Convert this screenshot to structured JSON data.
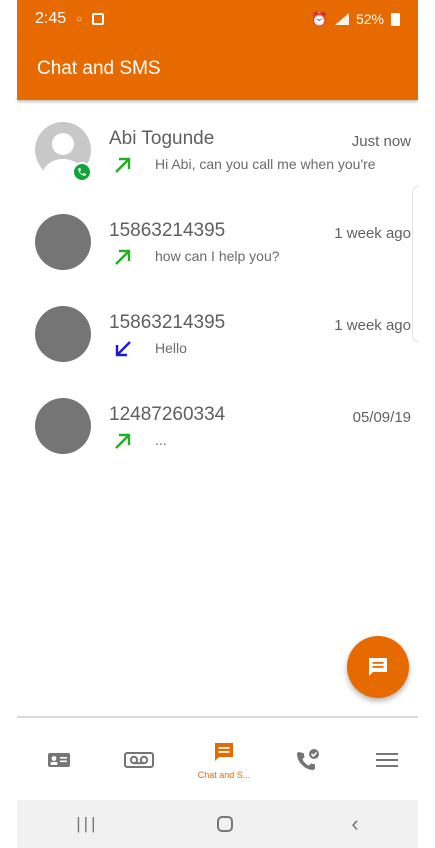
{
  "status_bar": {
    "time": "2:45",
    "battery": "52%"
  },
  "app_bar": {
    "title": "Chat and SMS"
  },
  "conversations": [
    {
      "name": "Abi Togunde",
      "time": "Just now",
      "direction": "outgoing",
      "snippet": "Hi Abi, can you call me when you're"
    },
    {
      "name": "15863214395",
      "time": "1 week ago",
      "direction": "outgoing",
      "snippet": "how can I help you?"
    },
    {
      "name": "15863214395",
      "time": "1 week ago",
      "direction": "incoming",
      "snippet": "Hello"
    },
    {
      "name": "12487260334",
      "time": "05/09/19",
      "direction": "outgoing",
      "snippet": "..."
    }
  ],
  "bottom_nav": {
    "active_label": "Chat and S..."
  },
  "colors": {
    "accent": "#e66a00",
    "outgoing_arrow": "#22b022",
    "incoming_arrow": "#1a1ad0",
    "call_badge": "#12a43a"
  }
}
